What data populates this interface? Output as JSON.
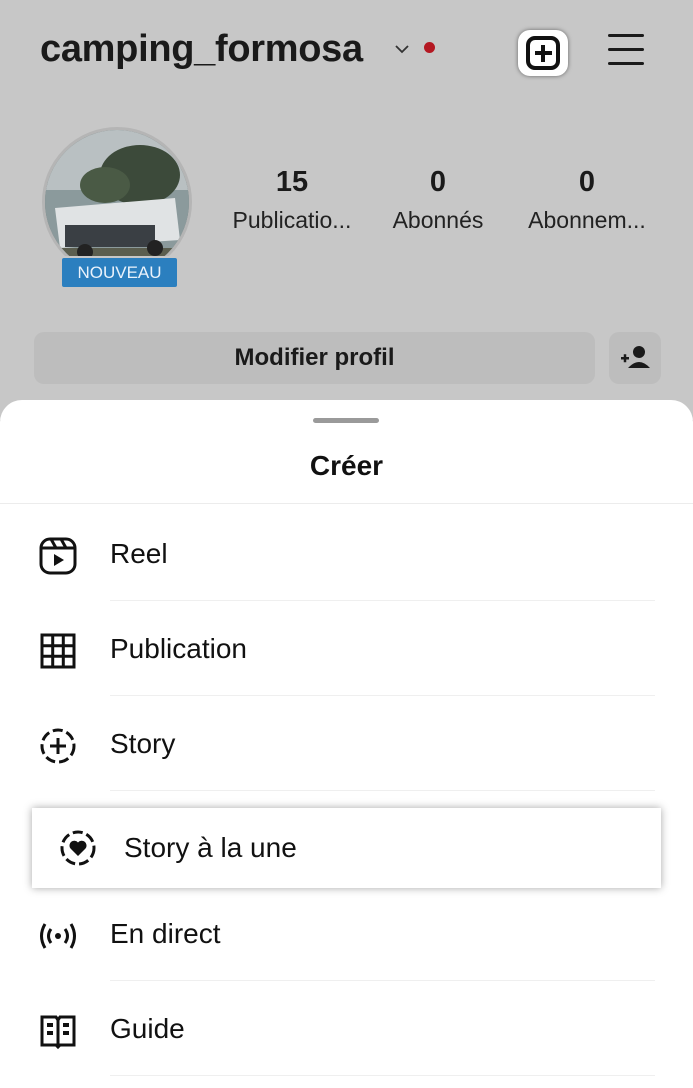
{
  "profile": {
    "username": "camping_formosa",
    "badge": "NOUVEAU",
    "stats": [
      {
        "value": "15",
        "label": "Publicatio..."
      },
      {
        "value": "0",
        "label": "Abonnés"
      },
      {
        "value": "0",
        "label": "Abonnem..."
      }
    ],
    "edit_button": "Modifier profil"
  },
  "sheet": {
    "title": "Créer",
    "items": [
      {
        "label": "Reel",
        "icon": "reel-icon"
      },
      {
        "label": "Publication",
        "icon": "grid-icon"
      },
      {
        "label": "Story",
        "icon": "story-add-icon"
      },
      {
        "label": "Story à la une",
        "icon": "highlight-heart-icon"
      },
      {
        "label": "En direct",
        "icon": "live-icon"
      },
      {
        "label": "Guide",
        "icon": "guide-book-icon"
      }
    ]
  },
  "colors": {
    "notification_dot": "#b41822",
    "badge": "#2b7fbf"
  }
}
